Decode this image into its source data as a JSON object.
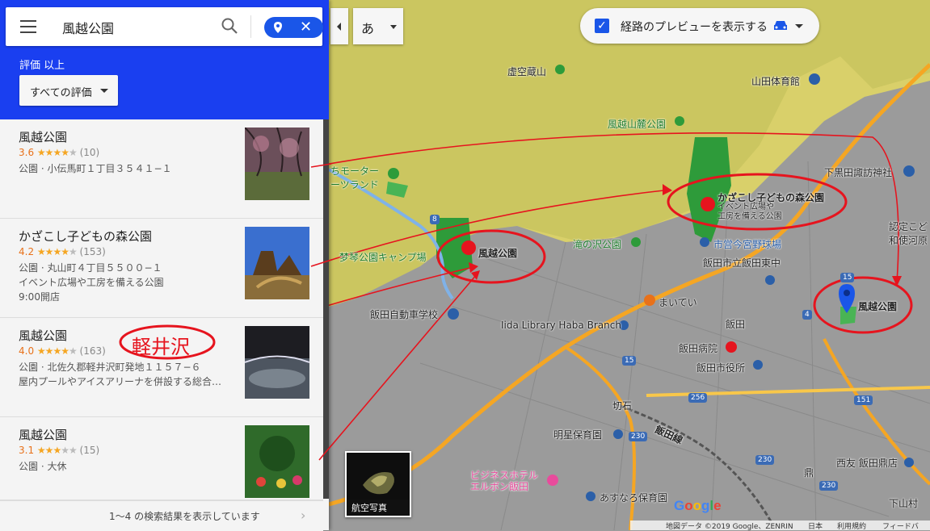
{
  "search": {
    "query": "風越公園",
    "menu_icon": "menu-icon",
    "search_icon": "search-icon",
    "close_icon": "close-icon"
  },
  "filter": {
    "rating_label": "評価 以上",
    "rating_button": "すべての評価"
  },
  "results": [
    {
      "name": "風越公園",
      "rating": "3.6",
      "stars": 3.5,
      "count": "(10)",
      "lines": [
        "公園 · 小伝馬町１丁目３５４１−１"
      ]
    },
    {
      "name": "かざこし子どもの森公園",
      "rating": "4.2",
      "stars": 4,
      "count": "(153)",
      "lines": [
        "公園 · 丸山町４丁目５５００−１",
        "イベント広場や工房を備える公園",
        "9:00開店"
      ]
    },
    {
      "name": "風越公園",
      "rating": "4.0",
      "stars": 4,
      "count": "(163)",
      "lines": [
        "公園 · 北佐久郡軽井沢町発地１１５７−６",
        "屋内プールやアイスアリーナを併設する総合…"
      ]
    },
    {
      "name": "風越公園",
      "rating": "3.1",
      "stars": 3,
      "count": "(15)",
      "lines": [
        "公園 · 大休"
      ]
    }
  ],
  "footer": {
    "text": "1〜4 の検索結果を表示しています",
    "arrow": "›"
  },
  "controls": {
    "ime_label": "あ",
    "route_preview": "経路のプレビューを表示する",
    "aerial_label": "航空写真"
  },
  "annotation": {
    "karuizawa": "軽井沢"
  },
  "map_labels": {
    "kokuzo": "虚空蔵山",
    "yamada_gym": "山田体育館",
    "kazakoshi_sanroku": "風越山麓公園",
    "motor_land": "ちモーター\nーツランド",
    "mori_park": "かざこし子どもの森公園",
    "mori_sub": "イベント広場や\n工房を備える公園",
    "kazakoshi_park": "風越公園",
    "camp": "梦琴公園キャンプ場",
    "takinosawa": "滝の沢公園",
    "miyamiya": "市営今宮野球場",
    "iida_higashi": "飯田市立飯田東中",
    "shimokuroda": "下黒田諏訪神社",
    "driving_school": "飯田自動車学校",
    "library": "Iida Library Haba Branch",
    "maitei": "まいてい",
    "iida": "飯田",
    "hospital": "飯田病院",
    "city_hall": "飯田市役所",
    "kiriishi": "切石",
    "meisei": "明星保育園",
    "iida_line": "飯田線",
    "hotel": "ビジネスホテル\nエルボン飯田",
    "asunaro": "あすなろ保育園",
    "nishitomo": "西友 飯田鼎店",
    "kanae": "鼎",
    "shimoyama": "下山村",
    "kazakoshi_pin": "風越公園",
    "ninshiki": "認定こど\n和使河原"
  },
  "bottom_bar": {
    "attribution": "地図データ ©2019 Google、ZENRIN",
    "region": "日本",
    "terms": "利用規約",
    "feedback": "フィードバ"
  },
  "route_numbers": [
    "8",
    "15",
    "15",
    "256",
    "230",
    "230",
    "151",
    "230",
    "4"
  ],
  "colors": {
    "header_blue": "#1a3ff0",
    "accent_blue": "#1a56e8",
    "star": "#f5a623",
    "rating_orange": "#e8711a",
    "annotation_red": "#e6141e",
    "park_green": "#2e9b3a",
    "road_orange": "#f5a623"
  }
}
